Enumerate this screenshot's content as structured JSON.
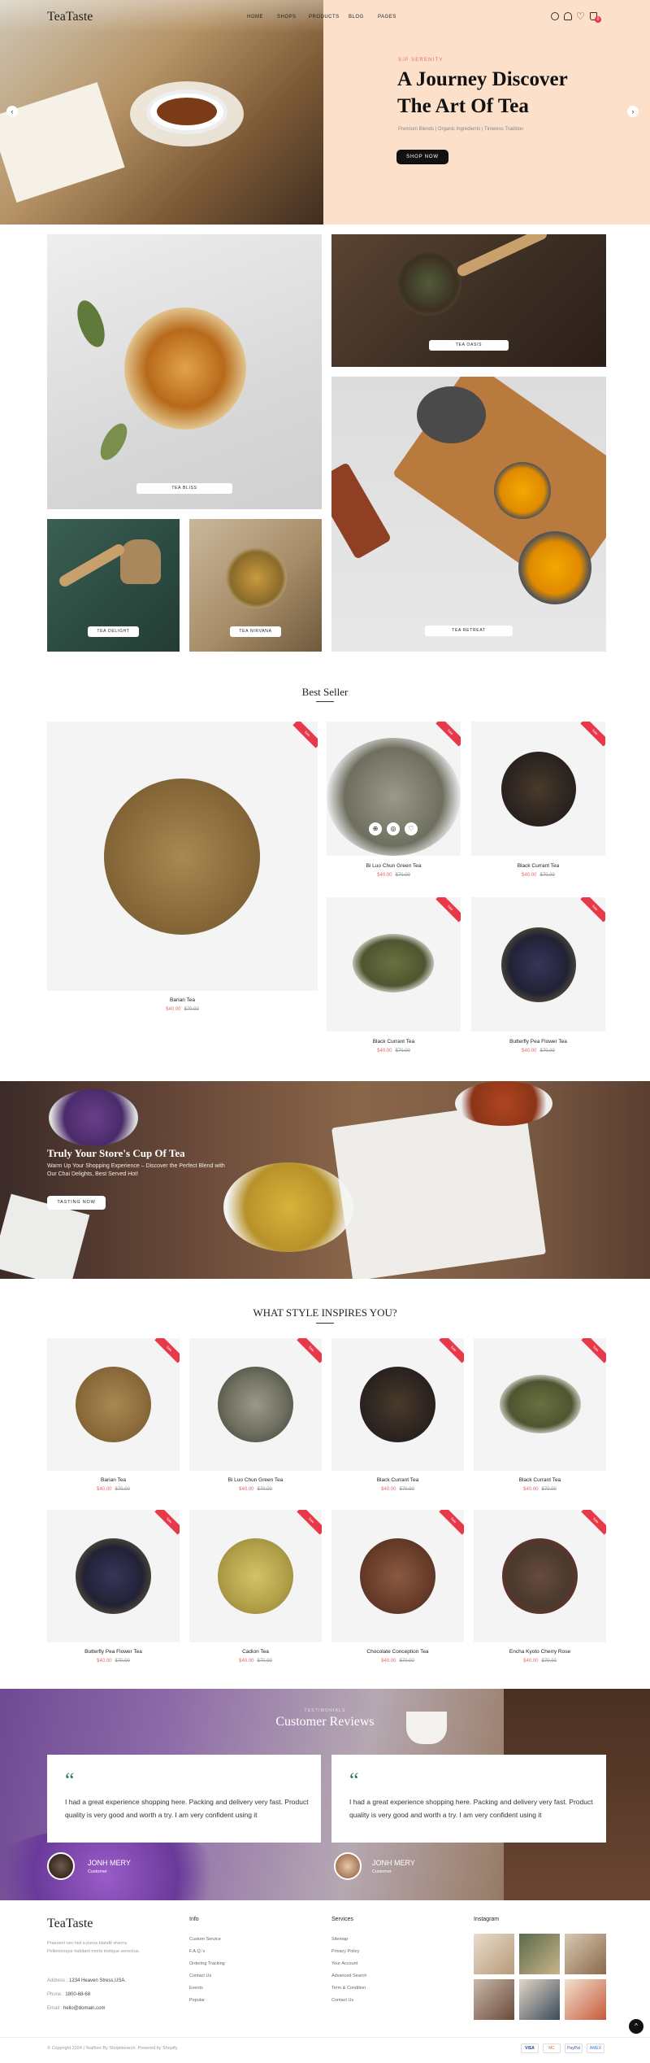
{
  "header": {
    "logo": "TeaTaste",
    "nav": [
      "HOME",
      "SHOPS",
      "PRODUCTS",
      "BLOG",
      "PAGES"
    ],
    "cart_count": "0"
  },
  "hero": {
    "eyebrow": "SIP SERENITY",
    "title_line1": "A Journey Discover",
    "title_line2": "The Art Of Tea",
    "subtitle": "Premium Blends | Organic Ingredients | Timeless Tradition",
    "button": "SHOP NOW"
  },
  "tiles": [
    "TEA BLISS",
    "TEA OASIS",
    "TEA DELIGHT",
    "TEA NIRVANA",
    "TEA RETREAT"
  ],
  "bestseller": {
    "title": "Best Seller",
    "products": [
      {
        "name": "Barian Tea",
        "price": "$40.00",
        "old": "$70.00",
        "badge": "Sale"
      },
      {
        "name": "Bi Luo Chun Green Tea",
        "price": "$40.00",
        "old": "$70.00",
        "badge": "Sale"
      },
      {
        "name": "Black Currant Tea",
        "price": "$40.00",
        "old": "$70.00",
        "badge": "Sale"
      },
      {
        "name": "Black Currant Tea",
        "price": "$40.00",
        "old": "$70.00",
        "badge": "Sale"
      },
      {
        "name": "Butterfly Pea Flower Tea",
        "price": "$40.00",
        "old": "$70.00",
        "badge": "Sale"
      }
    ]
  },
  "promo": {
    "title": "Truly Your Store's Cup Of Tea",
    "text": "Warm Up Your Shopping Experience – Discover the Perfect Blend with Our Chai Delights, Best Served Hot!",
    "button": "TASTING NOW"
  },
  "inspire": {
    "title": "WHAT STYLE INSPIRES YOU?",
    "products": [
      {
        "name": "Barian Tea",
        "price": "$40.00",
        "old": "$70.00",
        "badge": "Sale"
      },
      {
        "name": "Bi Luo Chun Green Tea",
        "price": "$40.00",
        "old": "$70.00",
        "badge": "Sale"
      },
      {
        "name": "Black Currant Tea",
        "price": "$40.00",
        "old": "$70.00",
        "badge": "Sale"
      },
      {
        "name": "Black Currant Tea",
        "price": "$40.00",
        "old": "$70.00",
        "badge": "Sale"
      },
      {
        "name": "Butterfly Pea Flower Tea",
        "price": "$40.00",
        "old": "$70.00",
        "badge": "Sale"
      },
      {
        "name": "Cadion Tea",
        "price": "$40.00",
        "old": "$70.00",
        "badge": "Sale"
      },
      {
        "name": "Chocolate Conception Tea",
        "price": "$40.00",
        "old": "$70.00",
        "badge": "Sale"
      },
      {
        "name": "Encha Kyoto Cherry Rose",
        "price": "$40.00",
        "old": "$70.00",
        "badge": "Sale"
      }
    ]
  },
  "reviews": {
    "eyebrow": "TESTIMONIALS",
    "title": "Customer Reviews",
    "items": [
      {
        "text": "I had a great experience shopping here. Packing and delivery very fast. Product quality is very good and worth a try. I am very confident using it",
        "name": "JONH MERY",
        "role": "Customer"
      },
      {
        "text": "I had a great experience shopping here. Packing and delivery very fast. Product quality is very good and worth a try. I am very confident using it",
        "name": "JONH MERY",
        "role": "Customer"
      }
    ]
  },
  "footer": {
    "logo": "TeaTaste",
    "about": "Praesent nec nisl a purus blandit viverra. Pellentesque habitant morbi tristique senectus.",
    "address_label": "Address :",
    "address": "1234 Heaven Stress,USA.",
    "phone_label": "Phone :",
    "phone": "1800-68-68",
    "email_label": "Email :",
    "email": "hello@domain.com",
    "info_title": "Info",
    "info": [
      "Custom Service",
      "F.A.Q.'s",
      "Ordering Tracking",
      "Contact Us",
      "Events",
      "Popular"
    ],
    "services_title": "Services",
    "services": [
      "Sitemap",
      "Privacy Policy",
      "Your Account",
      "Advanced Search",
      "Term & Condition",
      "Contact Us"
    ],
    "instagram_title": "Instagram",
    "copyright": "© Copyright 2024 | Teaflore By Shopitsearch. Powered by Shopify.",
    "payments": [
      "VISA",
      "MC",
      "PayPal",
      "AMEX"
    ]
  },
  "colors": {
    "hero_bg": "#fde0ca",
    "accent": "#e8394b",
    "price": "#e36b6b",
    "quote": "#2d7a60"
  }
}
